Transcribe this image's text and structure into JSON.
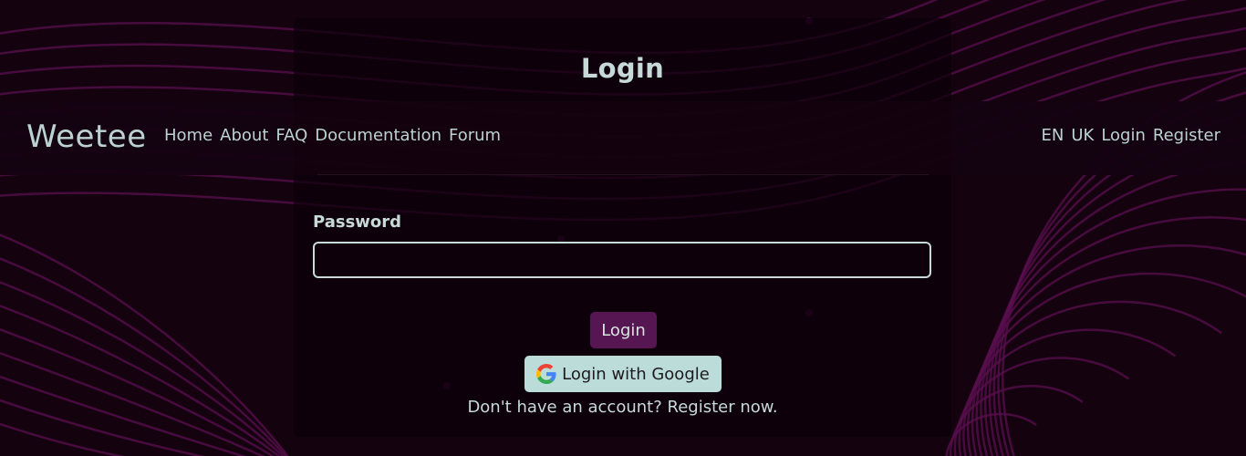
{
  "navbar": {
    "brand": "Weetee",
    "left_links": [
      "Home",
      "About",
      "FAQ",
      "Documentation",
      "Forum"
    ],
    "right_links": [
      "EN",
      "UK",
      "Login",
      "Register"
    ]
  },
  "login_card": {
    "title": "Login",
    "password_label": "Password",
    "password_value": "",
    "login_button": "Login",
    "google_button": "Login with Google",
    "register_prompt": "Don't have an account?",
    "register_link": "Register now."
  },
  "colors": {
    "background": "#14020f",
    "accent_line": "#5a0f4f",
    "login_button": "#551651",
    "google_button": "#bcdcd9",
    "text": "#c7dad8"
  },
  "icons": {
    "google": "google-icon"
  }
}
